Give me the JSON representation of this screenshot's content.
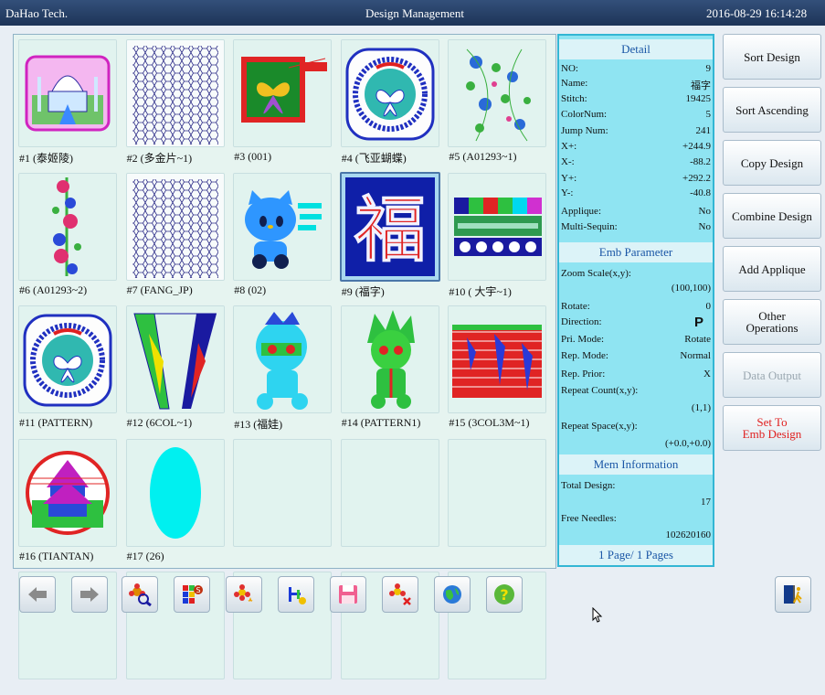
{
  "titlebar": {
    "company": "DaHao Tech.",
    "title": "Design Management",
    "datetime": "2016-08-29 16:14:28"
  },
  "designs": [
    {
      "label": "#1  (泰姬陵)",
      "art": "tajmahal"
    },
    {
      "label": "#2  (多金片~1)",
      "art": "hexmesh"
    },
    {
      "label": "#3  (001)",
      "art": "butterfly-frame"
    },
    {
      "label": "#4  (飞亚蝴蝶)",
      "art": "butterfly-round"
    },
    {
      "label": "#5  (A01293~1)",
      "art": "floral"
    },
    {
      "label": "#6  (A01293~2)",
      "art": "floral-column"
    },
    {
      "label": "#7  (FANG_JP)",
      "art": "hexmesh"
    },
    {
      "label": "#8  (02)",
      "art": "hellokitty"
    },
    {
      "label": "#9  (福字)",
      "art": "fu"
    },
    {
      "label": "#10  ( 大宇~1)",
      "art": "colorbar"
    },
    {
      "label": "#11  (PATTERN)",
      "art": "butterfly-round"
    },
    {
      "label": "#12  (6COL~1)",
      "art": "collar"
    },
    {
      "label": "#13  (福娃)",
      "art": "mascot-cyan"
    },
    {
      "label": "#14  (PATTERN1)",
      "art": "mascot-green"
    },
    {
      "label": "#15  (3COL3M~1)",
      "art": "stripes"
    },
    {
      "label": "#16  (TIANTAN)",
      "art": "temple"
    },
    {
      "label": "#17  (26)",
      "art": "oval"
    }
  ],
  "selected_design": "#9",
  "detail": {
    "heading": "Detail",
    "rows": [
      {
        "k": "NO:",
        "v": "9"
      },
      {
        "k": "Name:",
        "v": "福字"
      },
      {
        "k": "Stitch:",
        "v": "19425"
      },
      {
        "k": "ColorNum:",
        "v": "5"
      },
      {
        "k": "Jump Num:",
        "v": "241"
      },
      {
        "k": "X+:",
        "v": "+244.9"
      },
      {
        "k": "X-:",
        "v": "-88.2"
      },
      {
        "k": "Y+:",
        "v": "+292.2"
      },
      {
        "k": "Y-:",
        "v": "-40.8"
      },
      {
        "k": "Applique:",
        "v": "No"
      },
      {
        "k": "Multi-Sequin:",
        "v": "No"
      }
    ]
  },
  "emb": {
    "heading": "Emb Parameter",
    "zoom_label": "Zoom Scale(x,y):",
    "zoom_value": "(100,100)",
    "rotate_label": "Rotate:",
    "rotate_value": "0",
    "direction_label": "Direction:",
    "direction_value": "P",
    "pri_label": "Pri. Mode:",
    "pri_value": "Rotate",
    "rep_label": "Rep. Mode:",
    "rep_value": "Normal",
    "prior_label": "Rep. Prior:",
    "prior_value": "X",
    "count_label": "Repeat Count(x,y):",
    "count_value": "(1,1)",
    "space_label": "Repeat Space(x,y):",
    "space_value": "(+0.0,+0.0)"
  },
  "mem": {
    "heading": "Mem Information",
    "total_label": "Total Design:",
    "total_value": "17",
    "free_label": "Free Needles:",
    "free_value": "102620160"
  },
  "pages": "1 Page/ 1 Pages",
  "buttons": {
    "sort_design": "Sort Design",
    "sort_ascending": "Sort Ascending",
    "copy_design": "Copy Design",
    "combine_design": "Combine Design",
    "add_applique": "Add Applique",
    "other_operations": "Other\nOperations",
    "data_output": "Data Output",
    "set_to_emb": "Set To\nEmb Design"
  },
  "toolbar": [
    "arrow-left-icon",
    "arrow-right-icon",
    "flower-search-icon",
    "color-grid-icon",
    "flower-star-icon",
    "needle-bar-icon",
    "floppy-disk-icon",
    "flower-delete-icon",
    "globe-icon",
    "help-icon"
  ],
  "colors": {
    "accent_red": "#e02020",
    "panel_cyan": "#8fe4f2",
    "grid_bg": "#e6f4f0"
  }
}
